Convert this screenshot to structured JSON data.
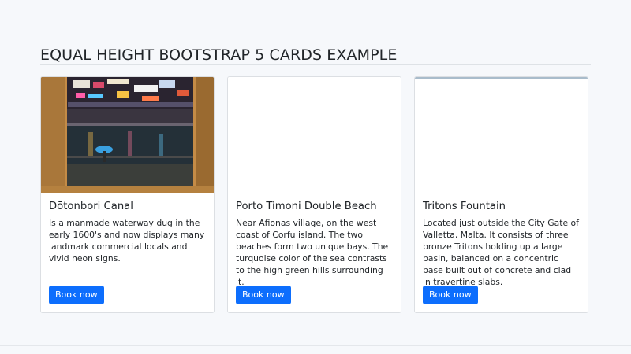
{
  "page": {
    "title": "EQUAL HEIGHT BOOTSTRAP 5 CARDS EXAMPLE"
  },
  "cards": [
    {
      "title": "Dōtonbori Canal",
      "text": "Is a manmade waterway dug in the early 1600's and now displays many landmark commercial locals and vivid neon signs.",
      "button": "Book now",
      "image": "night canal seen through a window"
    },
    {
      "title": "Porto Timoni Double Beach",
      "text": "Near Afionas village, on the west coast of Corfu island. The two beaches form two unique bays. The turquoise color of the sea contrasts to the high green hills surrounding it.",
      "button": "Book now",
      "image": "blank"
    },
    {
      "title": "Tritons Fountain",
      "text": "Located just outside the City Gate of Valletta, Malta. It consists of three bronze Tritons holding up a large basin, balanced on a concentric base built out of concrete and clad in travertine slabs.",
      "button": "Book now",
      "image": "blank"
    }
  ],
  "colors": {
    "background": "#f6f8fb",
    "button": "#0d6efd",
    "card_border": "#dcdfe3"
  }
}
